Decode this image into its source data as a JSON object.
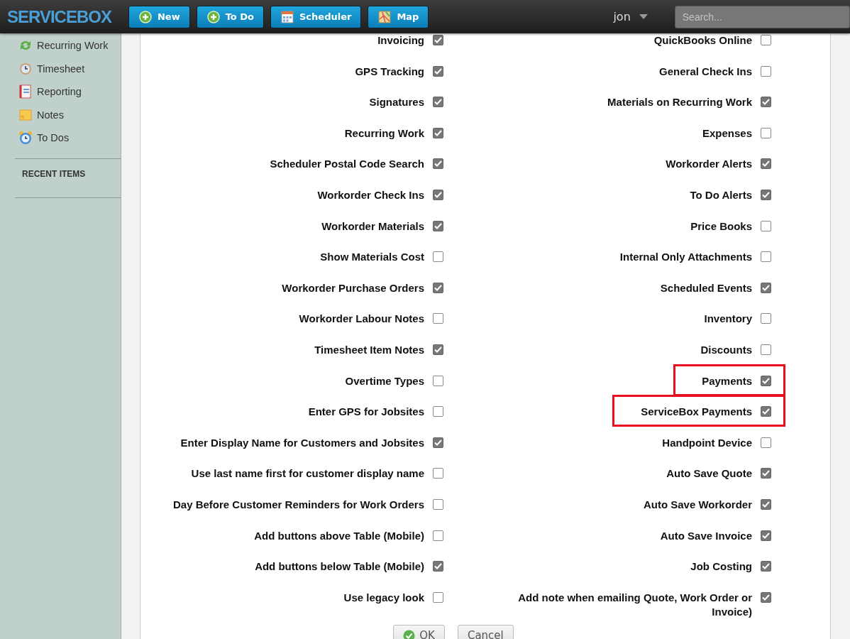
{
  "header": {
    "logo": "SERVICEBOX",
    "buttons": [
      {
        "label": "New",
        "kind": "plus"
      },
      {
        "label": "To Do",
        "kind": "plus"
      },
      {
        "label": "Scheduler",
        "kind": "calendar"
      },
      {
        "label": "Map",
        "kind": "map"
      }
    ],
    "user": "jon",
    "search": {
      "placeholder": "Search..."
    }
  },
  "sidebar": {
    "items": [
      {
        "label": "Recurring Work",
        "kind": "recurring"
      },
      {
        "label": "Timesheet",
        "kind": "clock"
      },
      {
        "label": "Reporting",
        "kind": "notebook"
      },
      {
        "label": "Notes",
        "kind": "note"
      },
      {
        "label": "To Dos",
        "kind": "alarm"
      }
    ],
    "recent_heading": "RECENT ITEMS"
  },
  "settings": {
    "rows": [
      {
        "left": {
          "label": "Invoicing",
          "checked": true
        },
        "right": {
          "label": "QuickBooks Online",
          "checked": false
        }
      },
      {
        "left": {
          "label": "GPS Tracking",
          "checked": true
        },
        "right": {
          "label": "General Check Ins",
          "checked": false
        }
      },
      {
        "left": {
          "label": "Signatures",
          "checked": true
        },
        "right": {
          "label": "Materials on Recurring Work",
          "checked": true
        }
      },
      {
        "left": {
          "label": "Recurring Work",
          "checked": true
        },
        "right": {
          "label": "Expenses",
          "checked": false
        }
      },
      {
        "left": {
          "label": "Scheduler Postal Code Search",
          "checked": true
        },
        "right": {
          "label": "Workorder Alerts",
          "checked": true
        }
      },
      {
        "left": {
          "label": "Workorder Check Ins",
          "checked": true
        },
        "right": {
          "label": "To Do Alerts",
          "checked": true
        }
      },
      {
        "left": {
          "label": "Workorder Materials",
          "checked": true
        },
        "right": {
          "label": "Price Books",
          "checked": false
        }
      },
      {
        "left": {
          "label": "Show Materials Cost",
          "checked": false
        },
        "right": {
          "label": "Internal Only Attachments",
          "checked": false
        }
      },
      {
        "left": {
          "label": "Workorder Purchase Orders",
          "checked": true
        },
        "right": {
          "label": "Scheduled Events",
          "checked": true
        }
      },
      {
        "left": {
          "label": "Workorder Labour Notes",
          "checked": false
        },
        "right": {
          "label": "Inventory",
          "checked": false
        }
      },
      {
        "left": {
          "label": "Timesheet Item Notes",
          "checked": true
        },
        "right": {
          "label": "Discounts",
          "checked": false
        }
      },
      {
        "left": {
          "label": "Overtime Types",
          "checked": false
        },
        "right": {
          "label": "Payments",
          "checked": true,
          "highlighted": true
        }
      },
      {
        "left": {
          "label": "Enter GPS for Jobsites",
          "checked": false
        },
        "right": {
          "label": "ServiceBox Payments",
          "checked": true,
          "highlighted": true
        }
      },
      {
        "left": {
          "label": "Enter Display Name for Customers and Jobsites",
          "checked": true
        },
        "right": {
          "label": "Handpoint Device",
          "checked": false
        }
      },
      {
        "left": {
          "label": "Use last name first for customer display name",
          "checked": false
        },
        "right": {
          "label": "Auto Save Quote",
          "checked": true
        }
      },
      {
        "left": {
          "label": "Day Before Customer Reminders for Work Orders",
          "checked": false
        },
        "right": {
          "label": "Auto Save Workorder",
          "checked": true
        }
      },
      {
        "left": {
          "label": "Add buttons above Table (Mobile)",
          "checked": false
        },
        "right": {
          "label": "Auto Save Invoice",
          "checked": true
        }
      },
      {
        "left": {
          "label": "Add buttons below Table (Mobile)",
          "checked": true
        },
        "right": {
          "label": "Job Costing",
          "checked": true
        }
      },
      {
        "left": {
          "label": "Use legacy look",
          "checked": false
        },
        "right": {
          "label": "Add note when emailing Quote, Work Order or Invoice)",
          "checked": true
        }
      }
    ],
    "ok": "OK",
    "cancel": "Cancel"
  }
}
